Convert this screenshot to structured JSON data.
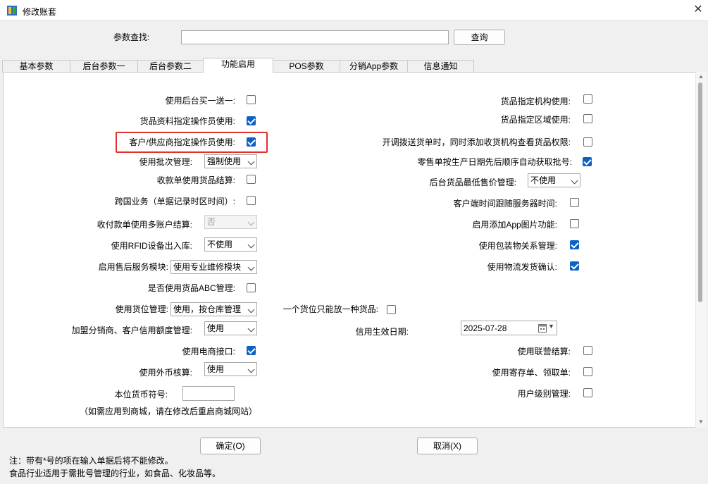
{
  "window": {
    "title": "修改账套",
    "close": "✕"
  },
  "search": {
    "label": "参数查找:",
    "value": "",
    "button": "查询"
  },
  "tabs": [
    "基本参数",
    "后台参数一",
    "后台参数二",
    "功能启用",
    "POS参数",
    "分销App参数",
    "信息通知"
  ],
  "active_tab": "功能启用",
  "left": [
    {
      "label": "使用后台买一送一:",
      "checked": false
    },
    {
      "label": "货品资料指定操作员使用:",
      "checked": true
    },
    {
      "label": "客户/供应商指定操作员使用:",
      "checked": true,
      "highlighted": true
    },
    {
      "label": "使用批次管理:",
      "select": "强制使用"
    },
    {
      "label": "收款单使用货品结算:",
      "checked": false
    },
    {
      "label": "跨国业务（单据记录时区时间）:",
      "checked": false
    },
    {
      "label": "收付款单使用多账户结算:",
      "select": "否",
      "disabled": true
    },
    {
      "label": "使用RFID设备出入库:",
      "select": "不使用"
    },
    {
      "label": "启用售后服务模块:",
      "select": "使用专业维修模块"
    },
    {
      "label": "是否使用货品ABC管理:",
      "checked": false
    },
    {
      "label": "使用货位管理:",
      "select": "使用，按仓库管理"
    },
    {
      "label": "加盟分销商、客户信用额度管理:",
      "select": "使用"
    },
    {
      "label": "使用电商接口:",
      "checked": true
    },
    {
      "label": "使用外币核算:",
      "select": "使用"
    },
    {
      "label": "本位货币符号:",
      "value": ""
    }
  ],
  "note_shop": "（如需应用到商城，请在修改后重启商城网站）",
  "mid": {
    "label": "一个货位只能放一种货品:",
    "checked": false
  },
  "right": [
    {
      "label": "货品指定机构使用:",
      "checked": false
    },
    {
      "label": "货品指定区域使用:",
      "checked": false
    },
    {
      "label": "开调拨送货单时，同时添加收货机构查看货品权限:",
      "checked": false
    },
    {
      "label": "零售单按生产日期先后顺序自动获取批号:",
      "checked": true
    },
    {
      "label": "后台货品最低售价管理:",
      "select": "不使用"
    },
    {
      "label": "客户端时间跟随服务器时间:",
      "checked": false
    },
    {
      "label": "启用添加App图片功能:",
      "checked": false
    },
    {
      "label": "使用包装物关系管理:",
      "checked": true
    },
    {
      "label": "使用物流发货确认:",
      "checked": true
    },
    {
      "label": "信用生效日期:",
      "date": "2025-07-28"
    },
    {
      "label": "使用联营结算:",
      "checked": false
    },
    {
      "label": "使用寄存单、领取单:",
      "checked": false
    },
    {
      "label": "用户级别管理:",
      "checked": false
    }
  ],
  "footer": {
    "ok": "确定(O)",
    "cancel": "取消(X)",
    "note1": "注：带有*号的项在输入单据后将不能修改。",
    "note2": "食品行业适用于需批号管理的行业，如食品、化妆品等。"
  },
  "colors": {
    "accent": "#0b61c4",
    "highlight": "#e0312b"
  },
  "icons": [
    "app-icon",
    "close-icon",
    "calendar-icon",
    "chevron-down-icon"
  ]
}
